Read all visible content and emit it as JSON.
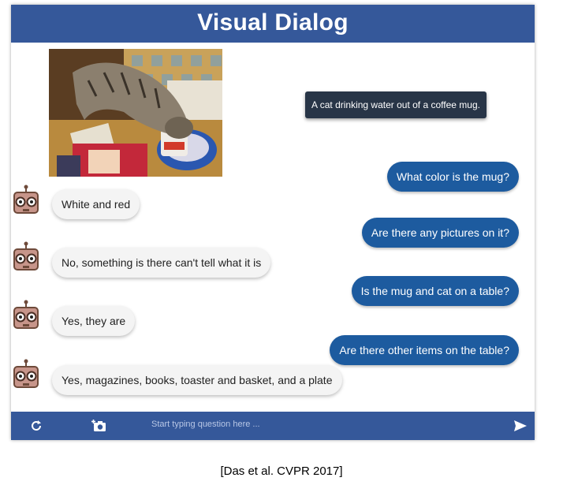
{
  "app": {
    "title": "Visual Dialog"
  },
  "caption": "A cat drinking water out of a coffee mug.",
  "dialog": [
    {
      "question": "What color is the mug?",
      "answer": "White and red"
    },
    {
      "question": "Are there any pictures on it?",
      "answer": "No, something is there can't tell what it is"
    },
    {
      "question": "Is the mug and cat on a table?",
      "answer": "Yes, they are"
    },
    {
      "question": "Are there other items on the table?",
      "answer": "Yes, magazines, books, toaster and basket, and a plate"
    }
  ],
  "footer": {
    "placeholder": "Start typing question here ...",
    "refresh_icon": "refresh-icon",
    "camera_icon": "add-photo-icon",
    "send_icon": "send-icon"
  },
  "citation": "[Das et al. CVPR 2017]",
  "colors": {
    "header": "#35589a",
    "question_bubble": "#1d5b9f",
    "answer_bubble": "#f4f4f4",
    "caption_bg": "#283547"
  }
}
